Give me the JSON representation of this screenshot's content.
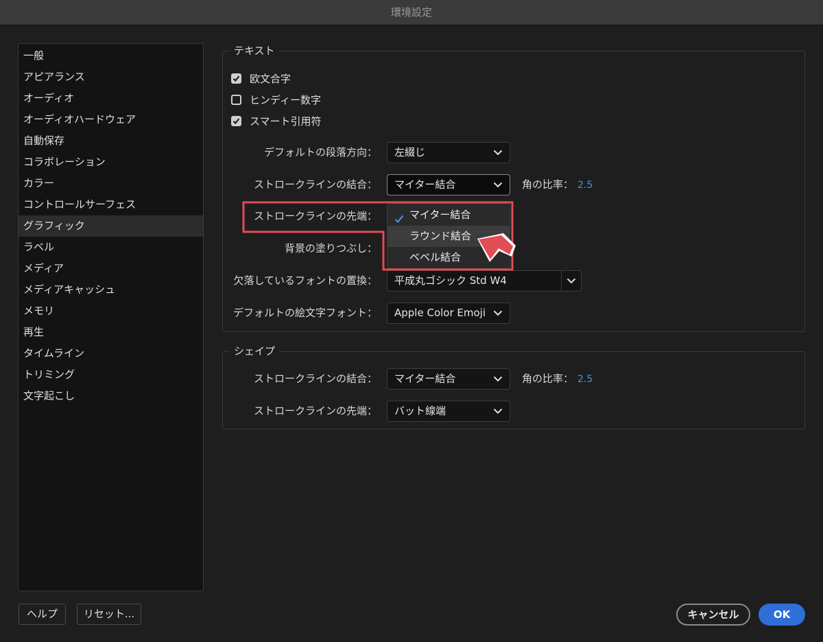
{
  "window": {
    "title": "環境設定"
  },
  "sidebar": {
    "items": [
      {
        "label": "一般"
      },
      {
        "label": "アピアランス"
      },
      {
        "label": "オーディオ"
      },
      {
        "label": "オーディオハードウェア"
      },
      {
        "label": "自動保存"
      },
      {
        "label": "コラボレーション"
      },
      {
        "label": "カラー"
      },
      {
        "label": "コントロールサーフェス"
      },
      {
        "label": "グラフィック",
        "selected": true
      },
      {
        "label": "ラベル"
      },
      {
        "label": "メディア"
      },
      {
        "label": "メディアキャッシュ"
      },
      {
        "label": "メモリ"
      },
      {
        "label": "再生"
      },
      {
        "label": "タイムライン"
      },
      {
        "label": "トリミング"
      },
      {
        "label": "文字起こし"
      }
    ]
  },
  "text_section": {
    "title": "テキスト",
    "checkboxes": [
      {
        "label": "欧文合字",
        "checked": true
      },
      {
        "label": "ヒンディー数字",
        "checked": false
      },
      {
        "label": "スマート引用符",
        "checked": true
      }
    ],
    "paragraph_direction": {
      "label": "デフォルトの段落方向：",
      "value": "左綴じ"
    },
    "stroke_join": {
      "label": "ストロークラインの結合：",
      "value": "マイター結合",
      "ratio_label": "角の比率：",
      "ratio_value": "2.5"
    },
    "stroke_cap": {
      "label": "ストロークラインの先端："
    },
    "background_fill": {
      "label": "背景の塗りつぶし："
    },
    "missing_font": {
      "label": "欠落しているフォントの置換：",
      "value": "平成丸ゴシック Std W4"
    },
    "emoji_font": {
      "label": "デフォルトの絵文字フォント：",
      "value": "Apple Color Emoji"
    }
  },
  "dropdown_menu": {
    "items": [
      {
        "label": "マイター結合",
        "checked": true
      },
      {
        "label": "ラウンド結合",
        "hover": true
      },
      {
        "label": "ベベル結合"
      }
    ]
  },
  "shape_section": {
    "title": "シェイプ",
    "stroke_join": {
      "label": "ストロークラインの結合：",
      "value": "マイター結合",
      "ratio_label": "角の比率：",
      "ratio_value": "2.5"
    },
    "stroke_cap": {
      "label": "ストロークラインの先端：",
      "value": "バット線端"
    }
  },
  "footer": {
    "help": "ヘルプ",
    "reset": "リセット...",
    "cancel": "キャンセル",
    "ok": "OK"
  },
  "colors": {
    "accent": "#2f6fd7",
    "highlight": "#e24c55"
  }
}
